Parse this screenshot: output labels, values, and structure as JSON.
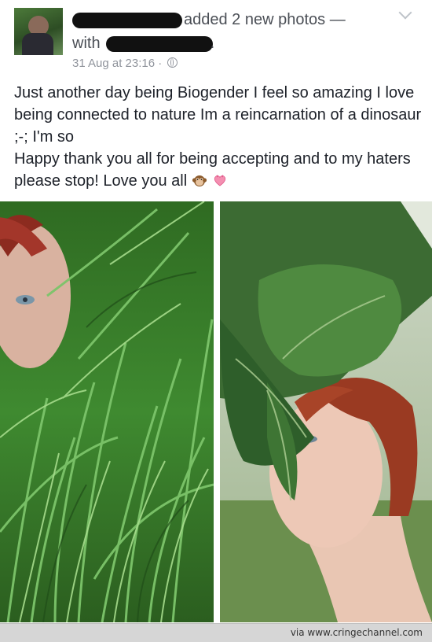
{
  "header": {
    "action_text": "added 2 new photos —",
    "with_text": "with",
    "period": ".",
    "timestamp": "31 Aug at 23:16 ·",
    "privacy_icon": "globe-icon",
    "menu_icon": "chevron-down-icon"
  },
  "post": {
    "text_line1": "Just another day being Biogender I feel so amazing I love being connected to nature Im a reincarnation of a dinosaur ;-;  I'm so",
    "text_line2": "Happy thank you all for being accepting and to my haters please stop! Love you all",
    "emojis": [
      "monkey-face-icon",
      "heart-ribbon-icon"
    ]
  },
  "photos": {
    "left": "grass-selfie-photo",
    "right": "leaf-selfie-photo"
  },
  "footer": {
    "credit": "via www.cringechannel.com"
  },
  "colors": {
    "text_primary": "#1d2129",
    "text_secondary": "#4b4f56",
    "text_meta": "#90949c",
    "footer_bg": "#d6d6d6"
  }
}
